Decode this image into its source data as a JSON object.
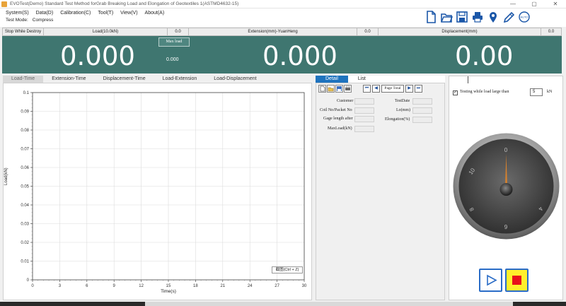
{
  "window": {
    "title": "EVOTest(Demo) Standard Test Method forGrab Breaking Load and Elongation of Geotextiles 1(ASTMD4632-15)",
    "controls": [
      "—",
      "▢",
      "✕"
    ]
  },
  "menu": [
    "System(S)",
    "Data(D)",
    "Calibration(C)",
    "Tool(T)",
    "View(V)",
    "About(A)"
  ],
  "test_mode": {
    "label": "Test Mode:",
    "value": "Compress"
  },
  "toolbar_icons": [
    "new-file-icon",
    "open-folder-icon",
    "save-icon",
    "print-icon",
    "location-pin-icon",
    "pencil-icon",
    "auto-zero-icon"
  ],
  "auto_zero_label": "AUTO",
  "header": {
    "stop": "Stop While Destroy",
    "load_label": "Load(10.0kN)",
    "load_value": "0.0",
    "extension_label": "Extension(mm)-YuanHeng",
    "extension_value": "0.0",
    "displacement_label": "Displacement(mm)",
    "displacement_value": "0.0"
  },
  "display": {
    "load": "0.000",
    "max_load_button": "Max load",
    "max_load_value": "0.000",
    "extension": "0.000",
    "displacement": "0.00"
  },
  "chart_tabs": [
    "Load-Time",
    "Extension-Time",
    "Displacement-Time",
    "Load-Extension",
    "Load-Displacement"
  ],
  "screenshot_button": "截图(Ctrl + Z)",
  "chart_data": {
    "type": "line",
    "xlabel": "Time(s)",
    "ylabel": "Load(kN)",
    "xlim": [
      0,
      30
    ],
    "ylim": [
      0,
      0.1
    ],
    "x_ticks": [
      "0",
      "3",
      "6",
      "9",
      "12",
      "15",
      "18",
      "21",
      "24",
      "27",
      "30"
    ],
    "y_ticks": [
      "0",
      "0.01",
      "0.02",
      "0.03",
      "0.04",
      "0.05",
      "0.06",
      "0.07",
      "0.08",
      "0.09",
      "0.1"
    ],
    "grid": true,
    "series": []
  },
  "detail_tabs": [
    "Detail",
    "List"
  ],
  "detail": {
    "page_total": "Page Total",
    "customer": "Customer",
    "test_date": "TestDate",
    "coil_no": "Coil No/Packet No",
    "lo": "Lo(mm)",
    "gage_length": "Gage length after",
    "elongation": "Elongation(%)",
    "max_load": "MaxLoad(kN)"
  },
  "right_panel": {
    "check_mark": "✓",
    "check_label": "Testing while load large than",
    "threshold": "5",
    "unit": "kN",
    "dial_labels": [
      "0",
      "10",
      "8",
      "9",
      "4"
    ]
  },
  "accent": "#3f7670",
  "stop_color": "#e8101a"
}
